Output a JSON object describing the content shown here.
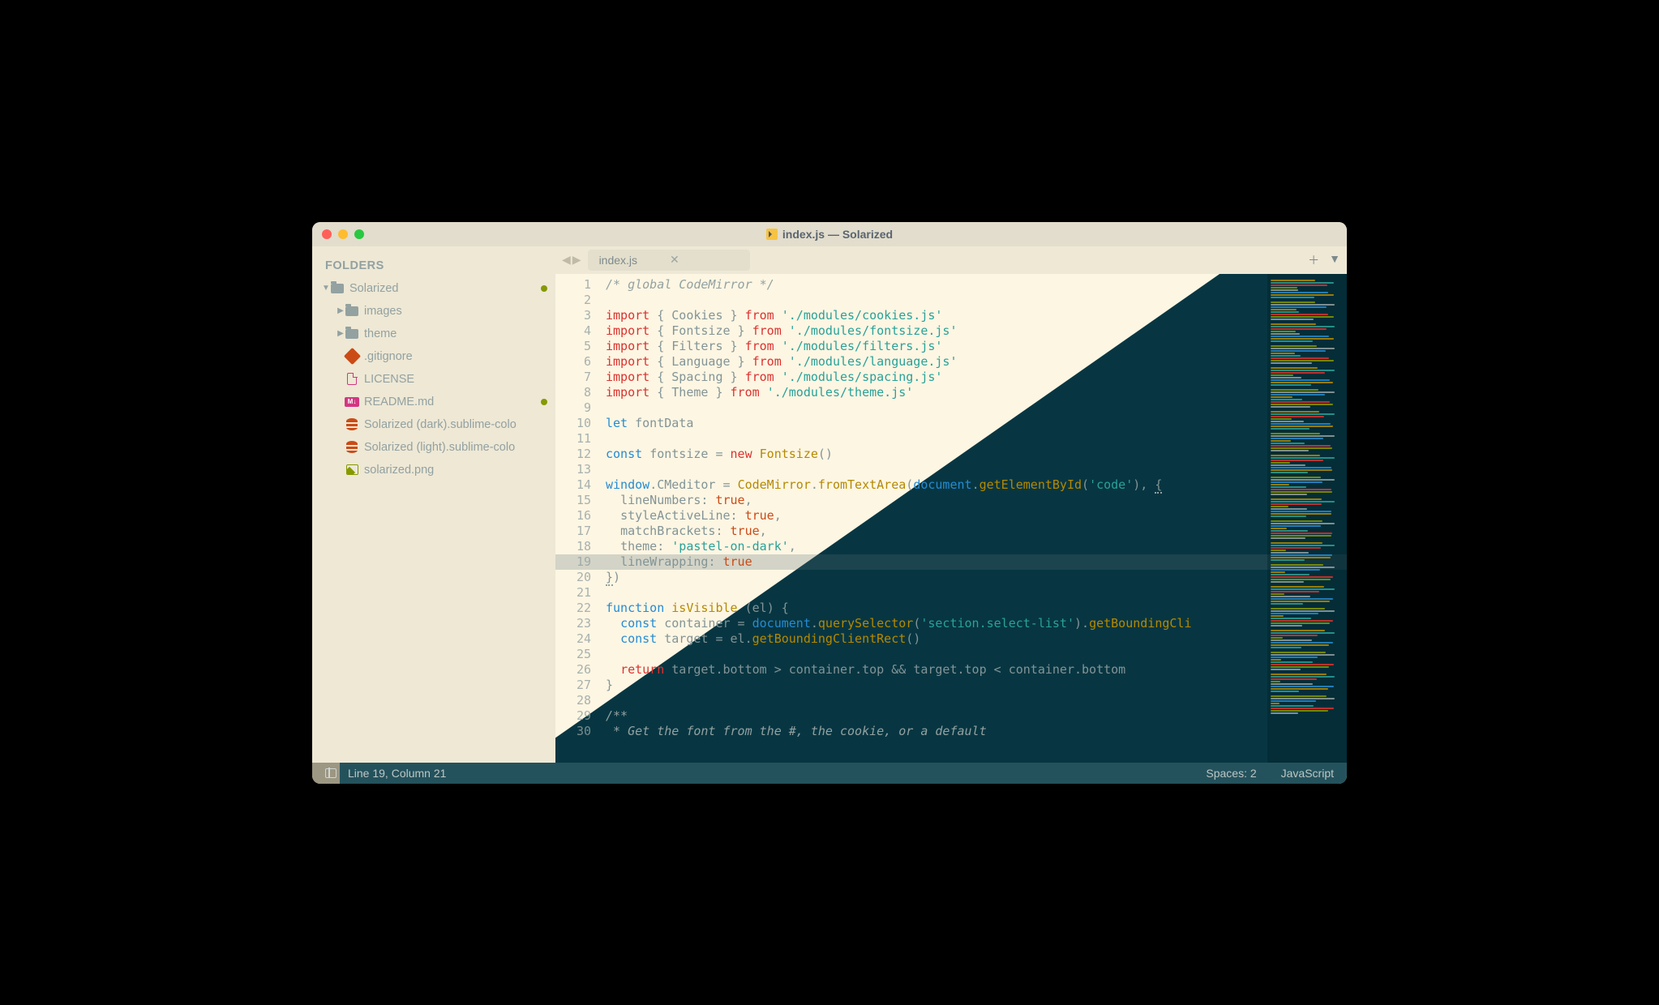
{
  "window": {
    "title": "index.js — Solarized"
  },
  "sidebar": {
    "header": "FOLDERS",
    "items": [
      {
        "label": "Solarized",
        "kind": "folder",
        "open": true,
        "indent": 0,
        "dirty": true
      },
      {
        "label": "images",
        "kind": "folder",
        "open": false,
        "indent": 1
      },
      {
        "label": "theme",
        "kind": "folder",
        "open": false,
        "indent": 1
      },
      {
        "label": ".gitignore",
        "kind": "git",
        "indent": 1
      },
      {
        "label": "LICENSE",
        "kind": "file",
        "indent": 1
      },
      {
        "label": "README.md",
        "kind": "md",
        "indent": 1,
        "dirty": true
      },
      {
        "label": "Solarized (dark).sublime-colo",
        "kind": "db",
        "indent": 1
      },
      {
        "label": "Solarized (light).sublime-colo",
        "kind": "db",
        "indent": 1
      },
      {
        "label": "solarized.png",
        "kind": "img",
        "indent": 1
      }
    ]
  },
  "tabs": {
    "active": {
      "label": "index.js"
    }
  },
  "editor": {
    "lines": [
      {
        "n": 1,
        "tokens": [
          [
            "c-com",
            "/* global CodeMirror */"
          ]
        ]
      },
      {
        "n": 2,
        "tokens": []
      },
      {
        "n": 3,
        "tokens": [
          [
            "c-kw",
            "import"
          ],
          [
            "c-pun",
            " { "
          ],
          [
            "c-id",
            "Cookies"
          ],
          [
            "c-pun",
            " } "
          ],
          [
            "c-kw",
            "from"
          ],
          [
            "c-pun",
            " "
          ],
          [
            "c-str",
            "'./modules/cookies.js'"
          ]
        ]
      },
      {
        "n": 4,
        "tokens": [
          [
            "c-kw",
            "import"
          ],
          [
            "c-pun",
            " { "
          ],
          [
            "c-id",
            "Fontsize"
          ],
          [
            "c-pun",
            " } "
          ],
          [
            "c-kw",
            "from"
          ],
          [
            "c-pun",
            " "
          ],
          [
            "c-str",
            "'./modules/fontsize.js'"
          ]
        ]
      },
      {
        "n": 5,
        "tokens": [
          [
            "c-kw",
            "import"
          ],
          [
            "c-pun",
            " { "
          ],
          [
            "c-id",
            "Filters"
          ],
          [
            "c-pun",
            " } "
          ],
          [
            "c-kw",
            "from"
          ],
          [
            "c-pun",
            " "
          ],
          [
            "c-str",
            "'./modules/filters.js'"
          ]
        ]
      },
      {
        "n": 6,
        "tokens": [
          [
            "c-kw",
            "import"
          ],
          [
            "c-pun",
            " { "
          ],
          [
            "c-id",
            "Language"
          ],
          [
            "c-pun",
            " } "
          ],
          [
            "c-kw",
            "from"
          ],
          [
            "c-pun",
            " "
          ],
          [
            "c-str",
            "'./modules/language.js'"
          ]
        ]
      },
      {
        "n": 7,
        "tokens": [
          [
            "c-kw",
            "import"
          ],
          [
            "c-pun",
            " { "
          ],
          [
            "c-id",
            "Spacing"
          ],
          [
            "c-pun",
            " } "
          ],
          [
            "c-kw",
            "from"
          ],
          [
            "c-pun",
            " "
          ],
          [
            "c-str",
            "'./modules/spacing.js'"
          ]
        ]
      },
      {
        "n": 8,
        "tokens": [
          [
            "c-kw",
            "import"
          ],
          [
            "c-pun",
            " { "
          ],
          [
            "c-id",
            "Theme"
          ],
          [
            "c-pun",
            " } "
          ],
          [
            "c-kw",
            "from"
          ],
          [
            "c-pun",
            " "
          ],
          [
            "c-str",
            "'./modules/theme.js'"
          ]
        ]
      },
      {
        "n": 9,
        "tokens": []
      },
      {
        "n": 10,
        "tokens": [
          [
            "c-kw2",
            "let"
          ],
          [
            "c-pun",
            " "
          ],
          [
            "c-id",
            "fontData"
          ]
        ]
      },
      {
        "n": 11,
        "tokens": []
      },
      {
        "n": 12,
        "tokens": [
          [
            "c-kw2",
            "const"
          ],
          [
            "c-pun",
            " "
          ],
          [
            "c-id",
            "fontsize"
          ],
          [
            "c-pun",
            " = "
          ],
          [
            "c-kw",
            "new"
          ],
          [
            "c-pun",
            " "
          ],
          [
            "c-fn",
            "Fontsize"
          ],
          [
            "c-pun",
            "()"
          ]
        ]
      },
      {
        "n": 13,
        "tokens": []
      },
      {
        "n": 14,
        "tokens": [
          [
            "c-kw2",
            "window"
          ],
          [
            "c-pun",
            "."
          ],
          [
            "c-id",
            "CMeditor"
          ],
          [
            "c-pun",
            " = "
          ],
          [
            "c-fn",
            "CodeMirror"
          ],
          [
            "c-pun",
            "."
          ],
          [
            "c-fn",
            "fromTextArea"
          ],
          [
            "c-pun",
            "("
          ],
          [
            "c-kw2",
            "document"
          ],
          [
            "c-pun",
            "."
          ],
          [
            "c-fn",
            "getElementById"
          ],
          [
            "c-pun",
            "("
          ],
          [
            "c-str",
            "'code'"
          ],
          [
            "c-pun",
            "), "
          ],
          [
            "c-pun uline",
            "{"
          ]
        ]
      },
      {
        "n": 15,
        "tokens": [
          [
            "c-pun",
            "  "
          ],
          [
            "c-id",
            "lineNumbers"
          ],
          [
            "c-pun",
            ": "
          ],
          [
            "c-true",
            "true"
          ],
          [
            "c-pun",
            ","
          ]
        ]
      },
      {
        "n": 16,
        "tokens": [
          [
            "c-pun",
            "  "
          ],
          [
            "c-id",
            "styleActiveLine"
          ],
          [
            "c-pun",
            ": "
          ],
          [
            "c-true",
            "true"
          ],
          [
            "c-pun",
            ","
          ]
        ]
      },
      {
        "n": 17,
        "tokens": [
          [
            "c-pun",
            "  "
          ],
          [
            "c-id",
            "matchBrackets"
          ],
          [
            "c-pun",
            ": "
          ],
          [
            "c-true",
            "true"
          ],
          [
            "c-pun",
            ","
          ]
        ]
      },
      {
        "n": 18,
        "tokens": [
          [
            "c-pun",
            "  "
          ],
          [
            "c-id",
            "theme"
          ],
          [
            "c-pun",
            ": "
          ],
          [
            "c-str",
            "'pastel-on-dark'"
          ],
          [
            "c-pun",
            ","
          ]
        ]
      },
      {
        "n": 19,
        "tokens": [
          [
            "c-pun",
            "  "
          ],
          [
            "c-id",
            "lineWrapping"
          ],
          [
            "c-pun",
            ": "
          ],
          [
            "c-true",
            "true"
          ]
        ],
        "active": true
      },
      {
        "n": 20,
        "tokens": [
          [
            "c-pun uline",
            "}"
          ],
          [
            "c-pun",
            ")"
          ]
        ]
      },
      {
        "n": 21,
        "tokens": []
      },
      {
        "n": 22,
        "tokens": [
          [
            "c-kw2",
            "function"
          ],
          [
            "c-pun",
            " "
          ],
          [
            "c-fn",
            "isVisible"
          ],
          [
            "c-pun",
            " ("
          ],
          [
            "c-id",
            "el"
          ],
          [
            "c-pun",
            ") {"
          ]
        ]
      },
      {
        "n": 23,
        "tokens": [
          [
            "c-pun",
            "  "
          ],
          [
            "c-kw2",
            "const"
          ],
          [
            "c-pun",
            " "
          ],
          [
            "c-id",
            "container"
          ],
          [
            "c-pun",
            " = "
          ],
          [
            "c-kw2",
            "document"
          ],
          [
            "c-pun",
            "."
          ],
          [
            "c-fn",
            "querySelector"
          ],
          [
            "c-pun",
            "("
          ],
          [
            "c-str",
            "'section.select-list'"
          ],
          [
            "c-pun",
            ")."
          ],
          [
            "c-fn",
            "getBoundingCli"
          ]
        ]
      },
      {
        "n": 24,
        "tokens": [
          [
            "c-pun",
            "  "
          ],
          [
            "c-kw2",
            "const"
          ],
          [
            "c-pun",
            " "
          ],
          [
            "c-id",
            "target"
          ],
          [
            "c-pun",
            " = "
          ],
          [
            "c-id",
            "el"
          ],
          [
            "c-pun",
            "."
          ],
          [
            "c-fn",
            "getBoundingClientRect"
          ],
          [
            "c-pun",
            "()"
          ]
        ]
      },
      {
        "n": 25,
        "tokens": []
      },
      {
        "n": 26,
        "tokens": [
          [
            "c-pun",
            "  "
          ],
          [
            "c-kw",
            "return"
          ],
          [
            "c-pun",
            " "
          ],
          [
            "c-id",
            "target"
          ],
          [
            "c-pun",
            "."
          ],
          [
            "c-id",
            "bottom"
          ],
          [
            "c-pun",
            " > "
          ],
          [
            "c-id",
            "container"
          ],
          [
            "c-pun",
            "."
          ],
          [
            "c-id",
            "top"
          ],
          [
            "c-pun",
            " && "
          ],
          [
            "c-id",
            "target"
          ],
          [
            "c-pun",
            "."
          ],
          [
            "c-id",
            "top"
          ],
          [
            "c-pun",
            " < "
          ],
          [
            "c-id",
            "container"
          ],
          [
            "c-pun",
            "."
          ],
          [
            "c-id",
            "bottom"
          ]
        ]
      },
      {
        "n": 27,
        "tokens": [
          [
            "c-pun",
            "}"
          ]
        ]
      },
      {
        "n": 28,
        "tokens": []
      },
      {
        "n": 29,
        "tokens": [
          [
            "c-com",
            "/**"
          ]
        ]
      },
      {
        "n": 30,
        "tokens": [
          [
            "c-com",
            " * Get the font from the #, the cookie, or a default"
          ]
        ]
      }
    ]
  },
  "statusbar": {
    "cursor": "Line 19, Column 21",
    "indent": "Spaces: 2",
    "syntax": "JavaScript"
  },
  "colors": {
    "solarized_base3": "#fdf6e3",
    "solarized_base2": "#eee8d5",
    "solarized_base02": "#073642",
    "accent_green": "#859900"
  }
}
